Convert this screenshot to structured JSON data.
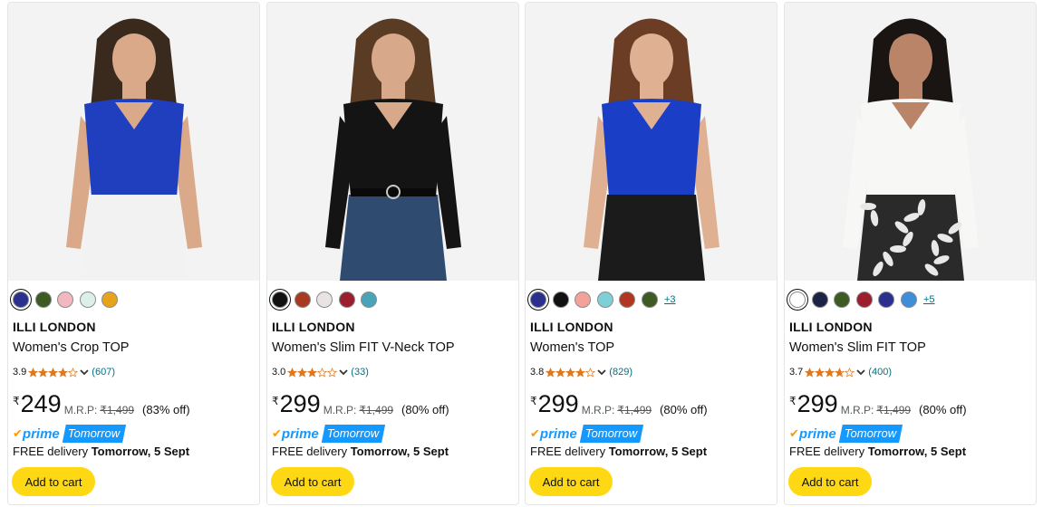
{
  "products": [
    {
      "brand": "ILLI LONDON",
      "title": "Women's Crop TOP",
      "rating": "3.9",
      "stars_value": 3.9,
      "review_count": "(607)",
      "currency": "₹",
      "price": "249",
      "mrp_label": "M.R.P:",
      "mrp": "₹1,499",
      "discount": "(83% off)",
      "prime_label": "prime",
      "prime_badge": "Tomorrow",
      "delivery_prefix": "FREE delivery ",
      "delivery_date": "Tomorrow, 5 Sept",
      "cart_label": "Add to cart",
      "swatches": [
        "#2b2f8e",
        "#3e5a23",
        "#f2b7bf",
        "#dcefe9",
        "#e8a31c"
      ],
      "more_colors": "",
      "image_colors": {
        "top": "#1f3fbf",
        "bottom": "#f2f2f2",
        "hair": "#3a2a1e",
        "skin": "#d9a98a"
      }
    },
    {
      "brand": "ILLI LONDON",
      "title": "Women's Slim FIT V-Neck TOP",
      "rating": "3.0",
      "stars_value": 3.0,
      "review_count": "(33)",
      "currency": "₹",
      "price": "299",
      "mrp_label": "M.R.P:",
      "mrp": "₹1,499",
      "discount": "(80% off)",
      "prime_label": "prime",
      "prime_badge": "Tomorrow",
      "delivery_prefix": "FREE delivery ",
      "delivery_date": "Tomorrow, 5 Sept",
      "cart_label": "Add to cart",
      "swatches": [
        "#111111",
        "#a83a22",
        "#e9e3e3",
        "#9b1d2e",
        "#4aa3b8"
      ],
      "more_colors": "",
      "image_colors": {
        "top": "#141414",
        "bottom": "#2f4b70",
        "hair": "#5a3b24",
        "skin": "#d8a88a"
      }
    },
    {
      "brand": "ILLI LONDON",
      "title": "Women's TOP",
      "rating": "3.8",
      "stars_value": 3.8,
      "review_count": "(829)",
      "currency": "₹",
      "price": "299",
      "mrp_label": "M.R.P:",
      "mrp": "₹1,499",
      "discount": "(80% off)",
      "prime_label": "prime",
      "prime_badge": "Tomorrow",
      "delivery_prefix": "FREE delivery ",
      "delivery_date": "Tomorrow, 5 Sept",
      "cart_label": "Add to cart",
      "swatches": [
        "#2b2f8e",
        "#111111",
        "#f4a199",
        "#7fd0d6",
        "#b2361f",
        "#3f5a23"
      ],
      "more_colors": "+3",
      "image_colors": {
        "top": "#1a3fc6",
        "bottom": "#1b1b1b",
        "hair": "#6b3d24",
        "skin": "#e0b092"
      }
    },
    {
      "brand": "ILLI LONDON",
      "title": "Women's Slim FIT TOP",
      "rating": "3.7",
      "stars_value": 3.7,
      "review_count": "(400)",
      "currency": "₹",
      "price": "299",
      "mrp_label": "M.R.P:",
      "mrp": "₹1,499",
      "discount": "(80% off)",
      "prime_label": "prime",
      "prime_badge": "Tomorrow",
      "delivery_prefix": "FREE delivery ",
      "delivery_date": "Tomorrow, 5 Sept",
      "cart_label": "Add to cart",
      "swatches": [
        "#ffffff",
        "#1d2347",
        "#3e5a23",
        "#9b1d2e",
        "#2b2f8e",
        "#3f8ed8"
      ],
      "more_colors": "+5",
      "image_colors": {
        "top": "#f7f7f5",
        "bottom": "#2a2a2a",
        "hair": "#1a1412",
        "skin": "#b98468"
      }
    }
  ],
  "colors": {
    "accent_button": "#ffd814",
    "link": "#007185",
    "star": "#de7921",
    "prime_blue": "#1399ff",
    "prime_check": "#ff9900"
  }
}
